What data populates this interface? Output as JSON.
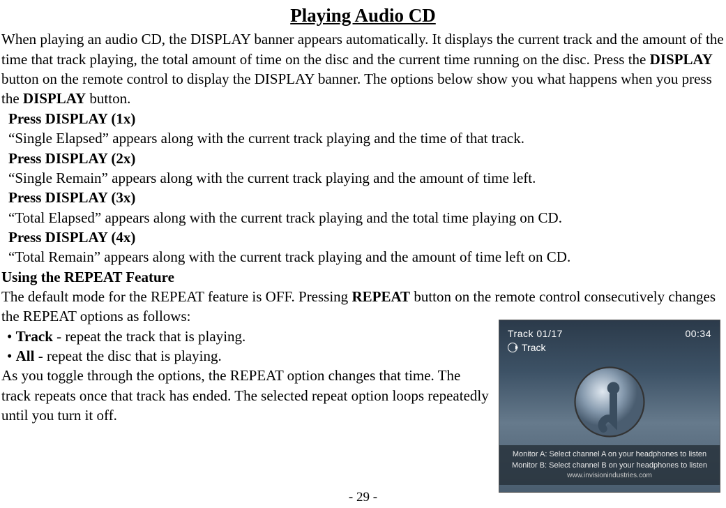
{
  "title": "Playing Audio CD",
  "intro": {
    "part1": "When playing an audio CD, the DISPLAY banner appears automatically. It displays the current track and the amount of the time that track playing, the total amount of time on the disc and the current time running on the disc. Press the ",
    "bold1": "DISPLAY",
    "part2": " button on the remote control to display the DISPLAY banner. The options below show you what happens when you press the ",
    "bold2": "DISPLAY",
    "part3": " button."
  },
  "display_presses": [
    {
      "label": "Press DISPLAY (1x)",
      "desc": "“Single Elapsed” appears along with the current track playing and the time of that track."
    },
    {
      "label": "Press DISPLAY (2x)",
      "desc": "“Single Remain” appears along with the current track playing and the amount of time left."
    },
    {
      "label": "Press DISPLAY (3x)",
      "desc": "“Total Elapsed” appears along with the current track playing and the total time playing on CD."
    },
    {
      "label": "Press DISPLAY (4x)",
      "desc": "“Total Remain” appears along with the current track playing and the amount of time left on CD."
    }
  ],
  "repeat_heading": "Using the REPEAT Feature",
  "repeat_intro": {
    "part1": "The default mode for the REPEAT feature is OFF. Pressing ",
    "bold1": "REPEAT",
    "part2": " button on the remote control consecutively changes the REPEAT options as follows:"
  },
  "repeat_bullets": [
    {
      "prefix": " • ",
      "bold": "Track",
      "rest": " - repeat the track that is playing."
    },
    {
      "prefix": " • ",
      "bold": "All",
      "rest": " - repeat the disc that is playing."
    }
  ],
  "repeat_outro": "As you toggle through the options, the REPEAT option changes that time. The track repeats once that track has ended. The selected repeat option loops repeatedly until you turn it off.",
  "image": {
    "track_label": "Track 01/17",
    "time": "00:34",
    "repeat_label": "Track",
    "monitor_a": "Monitor A: Select channel A on your headphones to listen",
    "monitor_b": "Monitor B: Select channel B on your headphones to listen",
    "url": "www.invisionindustries.com"
  },
  "page_number": "- 29 -"
}
